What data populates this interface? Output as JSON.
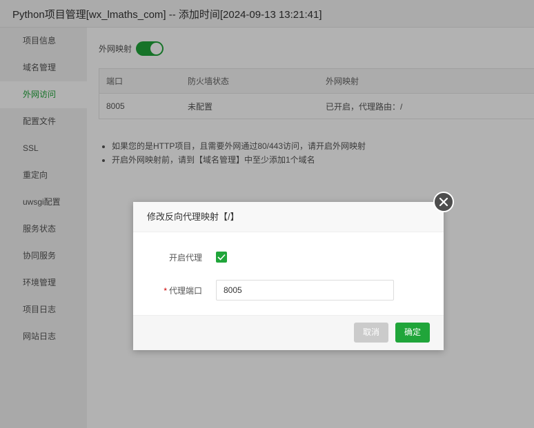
{
  "window": {
    "title": "Python项目管理[wx_lmaths_com] -- 添加时间[2024-09-13 13:21:41]"
  },
  "sidebar": {
    "items": [
      {
        "label": "项目信息"
      },
      {
        "label": "域名管理"
      },
      {
        "label": "外网访问",
        "active": true
      },
      {
        "label": "配置文件"
      },
      {
        "label": "SSL"
      },
      {
        "label": "重定向"
      },
      {
        "label": "uwsgi配置"
      },
      {
        "label": "服务状态"
      },
      {
        "label": "协同服务"
      },
      {
        "label": "环境管理"
      },
      {
        "label": "项目日志"
      },
      {
        "label": "网站日志"
      }
    ]
  },
  "main": {
    "mapping_label": "外网映射",
    "mapping_enabled": true,
    "table": {
      "headers": [
        "端口",
        "防火墙状态",
        "外网映射"
      ],
      "rows": [
        {
          "port": "8005",
          "firewall": "未配置",
          "mapping": "已开启，代理路由：/"
        }
      ]
    },
    "tips": [
      "如果您的是HTTP项目，且需要外网通过80/443访问，请开启外网映射",
      "开启外网映射前，请到【域名管理】中至少添加1个域名"
    ]
  },
  "dialog": {
    "title": "修改反向代理映射【/】",
    "enable_proxy_label": "开启代理",
    "enable_proxy_checked": true,
    "required_mark": "*",
    "proxy_port_label": "代理端口",
    "proxy_port_value": "8005",
    "cancel_label": "取消",
    "ok_label": "确定"
  },
  "colors": {
    "accent": "#20a53a",
    "error": "#cc0000",
    "cancel_button": "#cbcbcb"
  }
}
